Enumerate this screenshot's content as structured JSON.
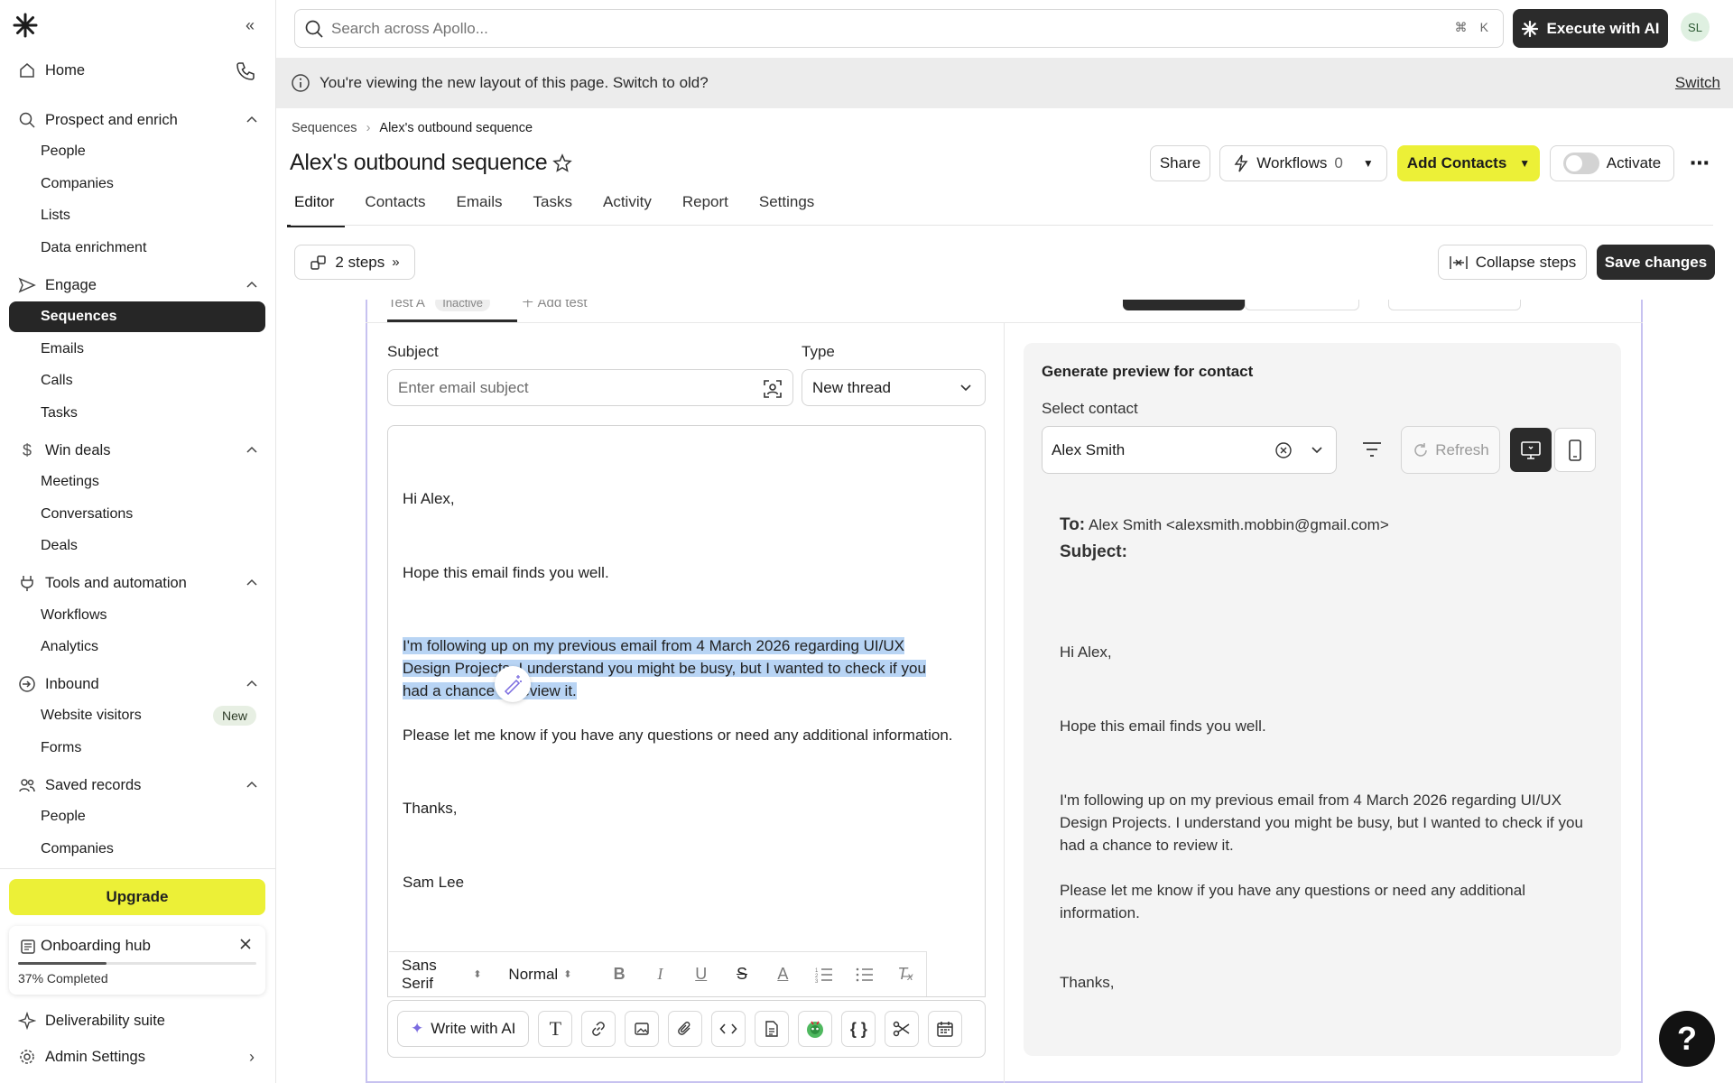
{
  "sidebar": {
    "home": "Home",
    "sections": [
      {
        "label": "Prospect and enrich",
        "items": [
          "People",
          "Companies",
          "Lists",
          "Data enrichment"
        ]
      },
      {
        "label": "Engage",
        "items": [
          "Sequences",
          "Emails",
          "Calls",
          "Tasks"
        ]
      },
      {
        "label": "Win deals",
        "items": [
          "Meetings",
          "Conversations",
          "Deals"
        ]
      },
      {
        "label": "Tools and automation",
        "items": [
          "Workflows",
          "Analytics"
        ]
      },
      {
        "label": "Inbound",
        "items": [
          "Website visitors",
          "Forms"
        ]
      },
      {
        "label": "Saved records",
        "items": [
          "People",
          "Companies"
        ]
      }
    ],
    "new_badge": "New",
    "upgrade": "Upgrade",
    "onboarding": {
      "title": "Onboarding hub",
      "progress_text": "37% Completed",
      "progress": 0.37
    },
    "deliverability": "Deliverability suite",
    "admin": "Admin Settings"
  },
  "topbar": {
    "search_placeholder": "Search across Apollo...",
    "shortcut_cmd": "⌘",
    "shortcut_key": "K",
    "execute_ai": "Execute with AI",
    "avatar_initials": "SL"
  },
  "notice": {
    "text": "You're viewing the new layout of this page. Switch to old?",
    "switch": "Switch"
  },
  "header": {
    "breadcrumb_root": "Sequences",
    "breadcrumb_current": "Alex's outbound sequence",
    "title": "Alex's outbound sequence",
    "share": "Share",
    "workflows": "Workflows",
    "workflows_count": "0",
    "add_contacts": "Add Contacts",
    "activate": "Activate"
  },
  "tabs": [
    "Editor",
    "Contacts",
    "Emails",
    "Tasks",
    "Activity",
    "Report",
    "Settings"
  ],
  "steps": {
    "label": "2 steps",
    "collapse": "Collapse steps",
    "save": "Save changes"
  },
  "editor": {
    "test_tab": "Test A",
    "test_status": "Inactive",
    "add_test": "Add test",
    "subject_label": "Subject",
    "subject_placeholder": "Enter email subject",
    "type_label": "Type",
    "type_value": "New thread",
    "body": {
      "greeting": "Hi Alex,",
      "line1": "Hope this email finds you well.",
      "hl1": "I'm following up on my previous email from 4 March 2026 regarding UI/UX",
      "hl2": "Design Projects. I understand you might be busy, but I wanted to check if you",
      "hl3": "had a chance to review it.",
      "line3": "Please let me know if you have any questions or need any additional information.",
      "signoff": "Thanks,",
      "name": "Sam Lee"
    },
    "format": {
      "font": "Sans Serif",
      "size": "Normal"
    },
    "write_ai": "Write with AI"
  },
  "preview": {
    "title": "Generate preview for contact",
    "select_label": "Select contact",
    "contact": "Alex Smith",
    "refresh": "Refresh",
    "to_label": "To:",
    "to_value": "Alex Smith <alexsmith.mobbin@gmail.com>",
    "subject_label": "Subject:",
    "greeting": "Hi Alex,",
    "line1": "Hope this email finds you well.",
    "p2": "I'm following up on my previous email from 4 March 2026 regarding UI/UX Design Projects. I understand you might be busy, but I wanted to check if you had a chance to review it.",
    "p3": "Please let me know if you have any questions or need any additional information.",
    "signoff": "Thanks,"
  },
  "help": "?"
}
